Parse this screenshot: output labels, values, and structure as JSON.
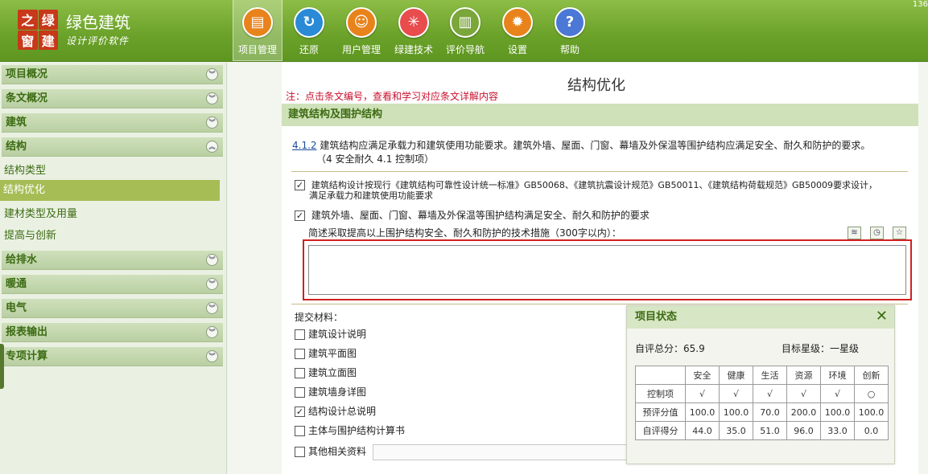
{
  "app": {
    "logo_chars": [
      "之",
      "绿",
      "窗",
      "建"
    ],
    "title": "绿色建筑",
    "subtitle": "设计评价软件",
    "corner_text": "136"
  },
  "toolbar": [
    {
      "label": "项目管理",
      "icon": "folder-icon",
      "glyph": "▤",
      "color": "#e8831c",
      "active": true
    },
    {
      "label": "还原",
      "icon": "refresh-icon",
      "glyph": "↻",
      "color": "#2a8ad6",
      "active": false
    },
    {
      "label": "用户管理",
      "icon": "user-icon",
      "glyph": "☺",
      "color": "#e8831c",
      "active": false
    },
    {
      "label": "绿建技术",
      "icon": "network-icon",
      "glyph": "✳",
      "color": "#e84c4c",
      "active": false
    },
    {
      "label": "评价导航",
      "icon": "book-icon",
      "glyph": "▥",
      "color": "#7aa63a",
      "active": false
    },
    {
      "label": "设置",
      "icon": "gear-icon",
      "glyph": "✹",
      "color": "#e8831c",
      "active": false
    },
    {
      "label": "帮助",
      "icon": "help-icon",
      "glyph": "?",
      "color": "#4b78d6",
      "active": false
    }
  ],
  "sidebar": {
    "sections": [
      {
        "label": "项目概况",
        "expanded": false
      },
      {
        "label": "条文概况",
        "expanded": false
      },
      {
        "label": "建筑",
        "expanded": false
      },
      {
        "label": "结构",
        "expanded": true
      },
      {
        "label": "给排水",
        "expanded": false
      },
      {
        "label": "暖通",
        "expanded": false
      },
      {
        "label": "电气",
        "expanded": false
      },
      {
        "label": "报表输出",
        "expanded": false
      },
      {
        "label": "专项计算",
        "expanded": false
      }
    ],
    "sub_items": [
      {
        "label": "结构类型",
        "active": false
      },
      {
        "label": "结构优化",
        "active": true
      },
      {
        "label": "建材类型及用量",
        "active": false
      },
      {
        "label": "提高与创新",
        "active": false
      }
    ]
  },
  "main": {
    "page_title": "结构优化",
    "note": "注：点击条文编号，查看和学习对应条文详解内容",
    "section_header": "建筑结构及围护结构",
    "clause": {
      "code": "4.1.2",
      "text": "建筑结构应满足承载力和建筑使用功能要求。建筑外墙、屋面、门窗、幕墙及外保温等围护结构应满足安全、耐久和防护的要求。",
      "category": "（4 安全耐久   4.1 控制项）"
    },
    "checks": [
      {
        "checked": true,
        "text": "建筑结构设计按现行《建筑结构可靠性设计统一标准》GB50068、《建筑抗震设计规范》GB50011、《建筑结构荷载规范》GB50009要求设计，",
        "text2": "满足承载力和建筑使用功能要求"
      },
      {
        "checked": true,
        "text": "建筑外墙、屋面、门窗、幕墙及外保温等围护结构满足安全、耐久和防护的要求",
        "text2": ""
      }
    ],
    "description_label": "简述采取提高以上围护结构安全、耐久和防护的技术措施（300字以内）：",
    "description_value": "",
    "materials_label": "提交材料：",
    "materials": [
      {
        "label": "建筑设计说明",
        "checked": false
      },
      {
        "label": "建筑平面图",
        "checked": false
      },
      {
        "label": "建筑立面图",
        "checked": false
      },
      {
        "label": "建筑墙身详图",
        "checked": false
      },
      {
        "label": "结构设计总说明",
        "checked": true
      },
      {
        "label": "主体与围护结构计算书",
        "checked": false
      },
      {
        "label": "其他相关资料",
        "checked": false
      }
    ]
  },
  "status_panel": {
    "title": "项目状态",
    "self_score_label": "自评总分：",
    "self_score": "65.9",
    "target_label": "目标星级：",
    "target": "一星级",
    "columns": [
      "安全",
      "健康",
      "生活",
      "资源",
      "环境",
      "创新"
    ],
    "rows": [
      {
        "label": "控制项",
        "cells": [
          "√",
          "√",
          "√",
          "√",
          "√",
          "○"
        ]
      },
      {
        "label": "预评分值",
        "cells": [
          "100.0",
          "100.0",
          "70.0",
          "200.0",
          "100.0",
          "100.0"
        ]
      },
      {
        "label": "自评得分",
        "cells": [
          "44.0",
          "35.0",
          "51.0",
          "96.0",
          "33.0",
          "0.0"
        ]
      }
    ]
  }
}
